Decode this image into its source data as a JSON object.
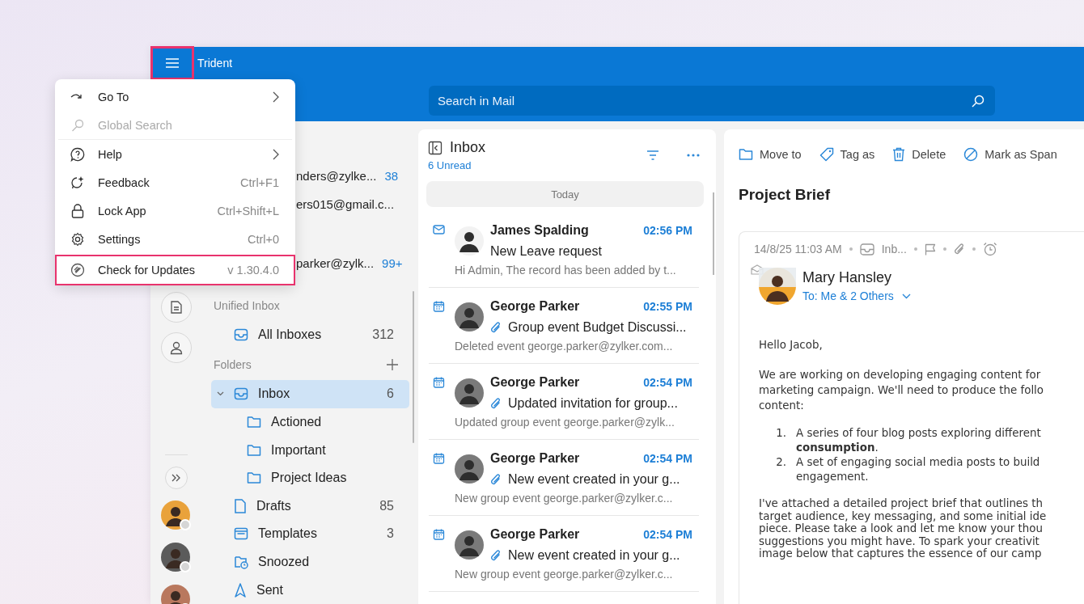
{
  "window": {
    "title": "Trident",
    "menu_button": {
      "highlighted": true
    }
  },
  "search": {
    "placeholder": "Search in Mail"
  },
  "app_menu": {
    "sections": [
      [
        {
          "label": "Go To",
          "kind": "goto",
          "submenu": true,
          "disabled": false,
          "highlighted": false
        },
        {
          "label": "Global Search",
          "kind": "search",
          "submenu": false,
          "disabled": true,
          "highlighted": false
        }
      ],
      [
        {
          "label": "Help",
          "kind": "help",
          "submenu": true,
          "disabled": false,
          "highlighted": false
        },
        {
          "label": "Feedback",
          "kind": "feedback",
          "shortcut": "Ctrl+F1",
          "submenu": false,
          "disabled": false,
          "highlighted": false
        },
        {
          "label": "Lock App",
          "kind": "lock",
          "shortcut": "Ctrl+Shift+L",
          "submenu": false,
          "disabled": false,
          "highlighted": false
        },
        {
          "label": "Settings",
          "kind": "settings",
          "shortcut": "Ctrl+0",
          "submenu": false,
          "disabled": false,
          "highlighted": false
        },
        {
          "label": "Check for Updates",
          "kind": "update",
          "shortcut": "v 1.30.4.0",
          "submenu": false,
          "disabled": false,
          "highlighted": true
        }
      ]
    ]
  },
  "accounts": [
    {
      "email": "nders@zylke...",
      "count": "38"
    },
    {
      "email": "ers015@gmail.c..."
    },
    {
      "email": "parker@zylk...",
      "count": "99+"
    }
  ],
  "unified_inbox": {
    "heading": "Unified Inbox",
    "items": [
      {
        "name": "All Inboxes",
        "kind": "inbox",
        "count": "312",
        "selected": false
      }
    ]
  },
  "folders": {
    "heading": "Folders",
    "items": [
      {
        "name": "Inbox",
        "kind": "inbox",
        "count": "6",
        "selected": true,
        "expanded": true,
        "children": [
          {
            "name": "Actioned",
            "kind": "folder",
            "selected": false
          },
          {
            "name": "Important",
            "kind": "folder",
            "selected": false
          },
          {
            "name": "Project Ideas",
            "kind": "folder",
            "selected": false
          }
        ]
      },
      {
        "name": "Drafts",
        "kind": "drafts",
        "count": "85",
        "selected": false
      },
      {
        "name": "Templates",
        "kind": "templates",
        "count": "3",
        "selected": false
      },
      {
        "name": "Snoozed",
        "kind": "snoozed",
        "selected": false
      },
      {
        "name": "Sent",
        "kind": "sent",
        "selected": false
      }
    ]
  },
  "message_list": {
    "title": "Inbox",
    "unread": "6 Unread",
    "group": "Today",
    "messages": [
      {
        "kind": "mail",
        "sender": "James Spalding",
        "time": "02:56 PM",
        "subject": "New Leave request",
        "attachment": false,
        "preview": "Hi Admin, The record has been added by t..."
      },
      {
        "kind": "event",
        "sender": "George Parker",
        "time": "02:55 PM",
        "subject": "Group event Budget Discussi...",
        "attachment": true,
        "preview": "Deleted event george.parker@zylker.com..."
      },
      {
        "kind": "event",
        "sender": "George Parker",
        "time": "02:54 PM",
        "subject": "Updated invitation for group...",
        "attachment": true,
        "preview": "Updated group event george.parker@zylk..."
      },
      {
        "kind": "event",
        "sender": "George Parker",
        "time": "02:54 PM",
        "subject": "New event created in your g...",
        "attachment": true,
        "preview": "New group event george.parker@zylker.c..."
      },
      {
        "kind": "event",
        "sender": "George Parker",
        "time": "02:54 PM",
        "subject": "New event created in your g...",
        "attachment": true,
        "preview": "New group event george.parker@zylker.c..."
      }
    ]
  },
  "reading_pane": {
    "actions": [
      {
        "label": "Move to",
        "kind": "move"
      },
      {
        "label": "Tag as",
        "kind": "tag"
      },
      {
        "label": "Delete",
        "kind": "delete"
      },
      {
        "label": "Mark as Span",
        "kind": "spam"
      }
    ],
    "subject": "Project Brief",
    "meta": {
      "date": "14/8/25 11:03 AM",
      "folder": "Inb..."
    },
    "sender": "Mary Hansley",
    "recipients": "To: Me & 2 Others",
    "body": [
      {
        "kind": "paragraph",
        "compact": false,
        "text": "Hello Jacob,"
      },
      {
        "kind": "paragraph",
        "compact": false,
        "text": "We are working on developing engaging content for\nmarketing campaign. We'll need to produce the follo\ncontent:"
      },
      {
        "kind": "list",
        "items": [
          {
            "number": "1.",
            "text": "A series of four blog posts exploring different\n**consumption**."
          },
          {
            "number": "2.",
            "text": "A set of engaging social media posts to build\nengagement."
          }
        ]
      },
      {
        "kind": "paragraph",
        "compact": true,
        "text": "I've attached a detailed project brief that outlines th\ntarget audience, key messaging, and some initial ide\npiece. Please take a look and let me know your thou\nsuggestions you might have. To spark your creativit\nimage below that captures the essence of our camp"
      }
    ]
  }
}
